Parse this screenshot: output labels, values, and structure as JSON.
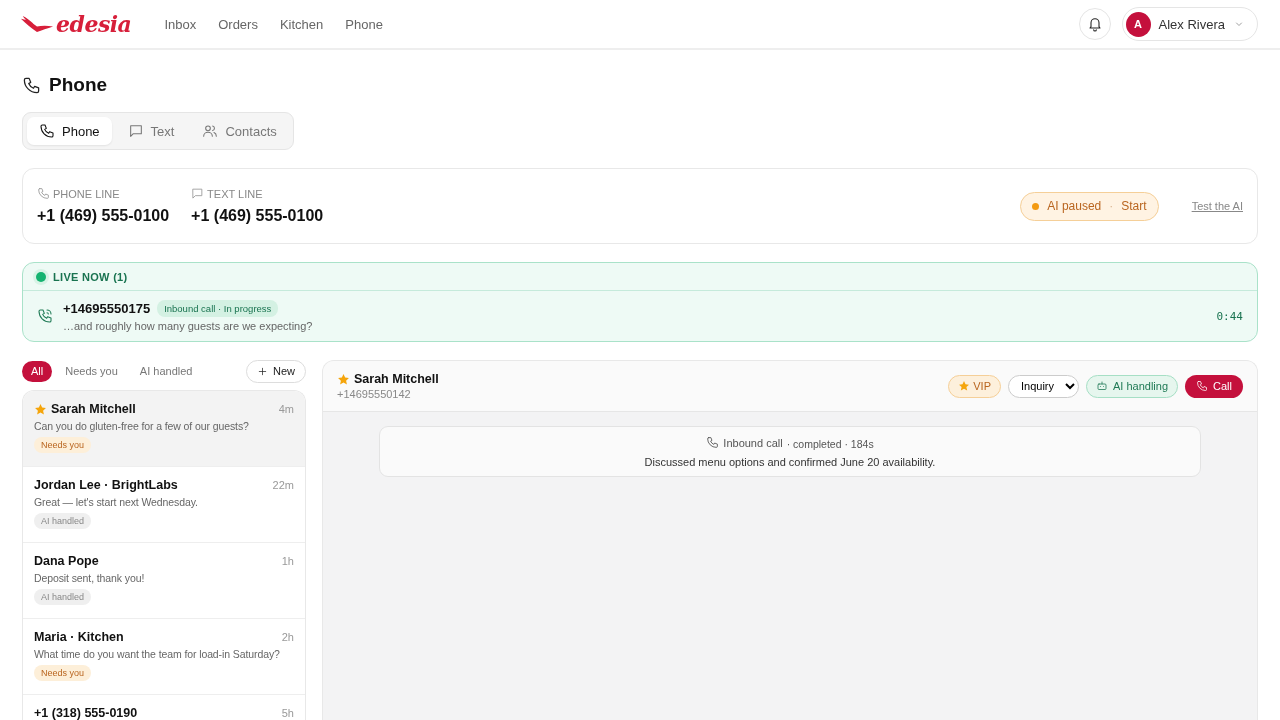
{
  "brand": {
    "name": "edesia"
  },
  "nav": [
    {
      "label": "Inbox"
    },
    {
      "label": "Orders"
    },
    {
      "label": "Kitchen"
    },
    {
      "label": "Phone"
    }
  ],
  "user": {
    "initial": "A",
    "name": "Alex Rivera"
  },
  "page": {
    "title": "Phone"
  },
  "tabs": [
    {
      "label": "Phone",
      "kind": "phone",
      "selected": true
    },
    {
      "label": "Text",
      "kind": "text",
      "selected": false
    },
    {
      "label": "Contacts",
      "kind": "contacts",
      "selected": false
    }
  ],
  "lines": [
    {
      "label": "PHONE LINE",
      "kind": "phone",
      "number": "+1 (469) 555-0100"
    },
    {
      "label": "TEXT LINE",
      "kind": "text",
      "number": "+1 (469) 555-0100"
    }
  ],
  "ai_status": {
    "label": "AI paused",
    "separator": "·",
    "action": "Start",
    "paused": true
  },
  "test_link": "Test the AI",
  "live": {
    "title": "LIVE NOW (1)",
    "calls": [
      {
        "number": "+14695550175",
        "badge": "Inbound call · In progress",
        "transcript": "…and roughly how many guests are we expecting?",
        "duration": "0:44"
      }
    ]
  },
  "filters": [
    {
      "label": "All",
      "selected": true
    },
    {
      "label": "Needs you",
      "selected": false
    },
    {
      "label": "AI handled",
      "selected": false
    }
  ],
  "new_button": "New",
  "conversations": [
    {
      "name": "Sarah Mitchell",
      "starred": true,
      "time": "4m",
      "preview": "Can you do gluten-free for a few of our guests?",
      "tag": {
        "label": "Needs you",
        "kind": "needs"
      },
      "selected": true
    },
    {
      "name": "Jordan Lee · BrightLabs",
      "starred": false,
      "time": "22m",
      "preview": "Great — let's start next Wednesday.",
      "tag": {
        "label": "AI handled",
        "kind": "ai"
      },
      "selected": false
    },
    {
      "name": "Dana Pope",
      "starred": false,
      "time": "1h",
      "preview": "Deposit sent, thank you!",
      "tag": {
        "label": "AI handled",
        "kind": "ai"
      },
      "selected": false
    },
    {
      "name": "Maria · Kitchen",
      "starred": false,
      "time": "2h",
      "preview": "What time do you want the team for load-in Saturday?",
      "tag": {
        "label": "Needs you",
        "kind": "needs"
      },
      "selected": false
    },
    {
      "name": "+1 (318) 555-0190",
      "starred": false,
      "time": "5h",
      "selected": false
    }
  ],
  "detail": {
    "name": "Sarah Mitchell",
    "starred": true,
    "phone": "+14695550142",
    "vip": "VIP",
    "stage": "Inquiry",
    "ai": "AI handling",
    "call": "Call",
    "events": [
      {
        "kind": "call",
        "title": "Inbound call",
        "meta": "· completed · 184s",
        "summary": "Discussed menu options and confirmed June 20 availability."
      }
    ]
  }
}
